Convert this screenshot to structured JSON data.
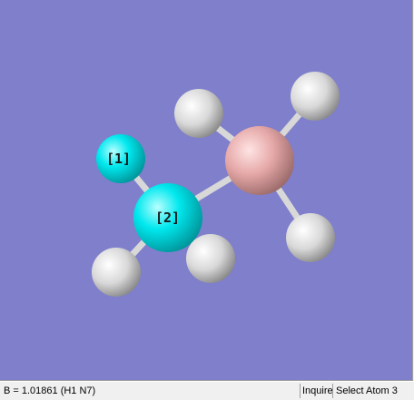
{
  "viewer": {
    "background_color": "#7f7fcc",
    "atoms": [
      {
        "element": "H",
        "label": "[1]",
        "color": "#00ffff"
      },
      {
        "element": "N",
        "label": "[2]",
        "color": "#00ffff"
      },
      {
        "element": "B",
        "label": "",
        "color": "#ffb5b5"
      },
      {
        "element": "H",
        "label": "",
        "color": "#ffffff"
      },
      {
        "element": "H",
        "label": "",
        "color": "#ffffff"
      },
      {
        "element": "H",
        "label": "",
        "color": "#ffffff"
      },
      {
        "element": "H",
        "label": "",
        "color": "#ffffff"
      },
      {
        "element": "H",
        "label": "",
        "color": "#ffffff"
      }
    ]
  },
  "status": {
    "measurement": "B = 1.01861 (H1 N7)",
    "mode": "Inquire",
    "action": "Select Atom 3"
  }
}
